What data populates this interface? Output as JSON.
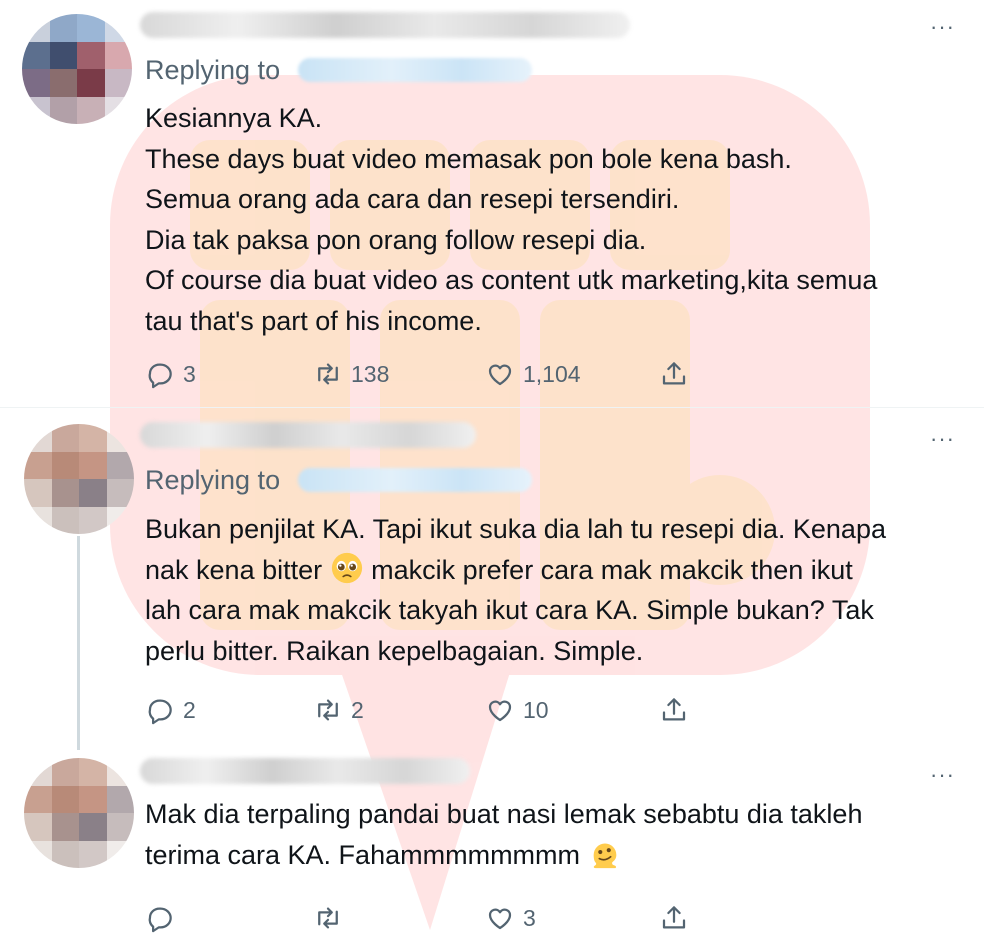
{
  "watermark": {
    "color": "#ff2d2d"
  },
  "tweets": [
    {
      "replying_to": "Replying to",
      "lines": [
        "Kesiannya KA.",
        "These days buat video memasak pon bole kena bash.",
        "Semua orang ada cara dan resepi tersendiri.",
        "Dia tak paksa pon orang follow resepi dia.",
        "Of course dia buat video as content utk marketing,kita semua",
        "tau that's part of his income."
      ],
      "more": "···",
      "replies": "3",
      "retweets": "138",
      "likes": "1,104"
    },
    {
      "replying_to": "Replying to",
      "line1": "Bukan penjilat KA. Tapi ikut suka dia lah tu resepi dia. Kenapa",
      "line2_a": "nak kena bitter",
      "line2_emoji": "pleading-face-emoji",
      "line2_b": "makcik prefer cara mak makcik then ikut",
      "line3": "lah cara mak makcik takyah ikut cara KA. Simple bukan? Tak",
      "line4": "perlu bitter. Raikan kepelbagaian. Simple.",
      "more": "···",
      "replies": "2",
      "retweets": "2",
      "likes": "10"
    },
    {
      "line1": "Mak dia terpaling pandai buat nasi lemak sebabtu dia takleh",
      "line2": "terima cara KA. Fahammmmmmmm",
      "line2_emoji": "melting-face-emoji",
      "more": "···",
      "likes": "3"
    }
  ],
  "colors": {
    "text": "#0f1419",
    "muted": "#536471",
    "divider": "#eff3f4"
  }
}
